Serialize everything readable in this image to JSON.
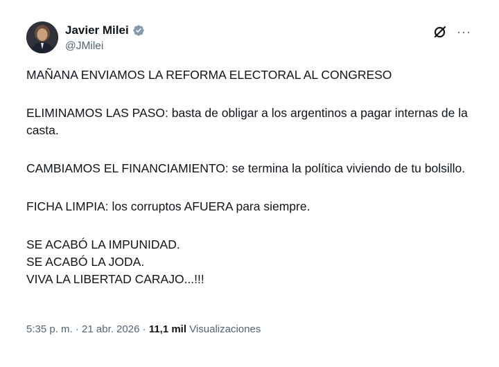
{
  "author": {
    "name": "Javier Milei",
    "handle": "@JMilei"
  },
  "tweet": {
    "paragraphs": [
      [
        "MAÑANA ENVIAMOS LA REFORMA ELECTORAL AL CONGRESO"
      ],
      [
        "ELIMINAMOS LAS PASO: basta de obligar a los argentinos a pagar internas de la casta."
      ],
      [
        "CAMBIAMOS EL FINANCIAMIENTO: se termina la política viviendo de tu bolsillo."
      ],
      [
        "FICHA LIMPIA: los corruptos AFUERA para siempre."
      ],
      [
        "SE ACABÓ LA IMPUNIDAD.",
        "SE ACABÓ LA JODA.",
        "VIVA LA LIBERTAD CARAJO...!!!"
      ]
    ]
  },
  "meta": {
    "time": "5:35 p. m.",
    "sep1": " · ",
    "date": "21 abr. 2026",
    "sep2": " · ",
    "views_count": "11,1 mil",
    "views_label": " Visualizaciones"
  },
  "colors": {
    "text": "#0f1419",
    "secondary": "#536471",
    "verified": "#1d9bf0"
  },
  "icons": [
    "verified-badge-icon",
    "grok-icon",
    "more-icon"
  ]
}
